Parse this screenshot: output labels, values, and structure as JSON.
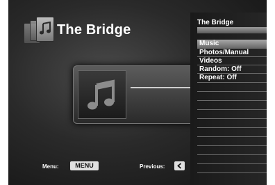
{
  "app": {
    "title": "The Bridge"
  },
  "panel": {
    "title": "The Bridge",
    "items": [
      {
        "label": "Music",
        "selected": true
      },
      {
        "label": "Photos/Manual",
        "selected": false
      },
      {
        "label": "Videos",
        "selected": false
      },
      {
        "label": "Random: Off",
        "selected": false
      },
      {
        "label": "Repeat: Off",
        "selected": false
      }
    ]
  },
  "footer": {
    "menu_label": "Menu:",
    "menu_key": "MENU",
    "previous_label": "Previous:"
  },
  "icons": {
    "logo": "media-stack-icon",
    "music": "music-note-icon",
    "back": "chevron-left-icon"
  }
}
